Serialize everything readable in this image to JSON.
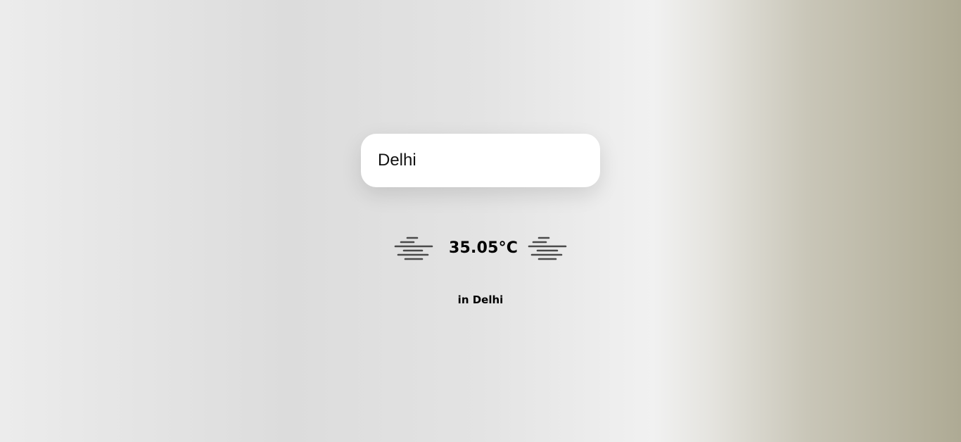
{
  "search": {
    "value": "Delhi",
    "placeholder": ""
  },
  "weather": {
    "temperature": "35.05°C",
    "location_text": "in Delhi",
    "condition_icon": "haze-icon"
  },
  "colors": {
    "background_left": "#ececec",
    "background_right": "#aeaa94",
    "card": "#ffffff",
    "icon_stroke": "#4a4a4a",
    "text": "#000000"
  }
}
